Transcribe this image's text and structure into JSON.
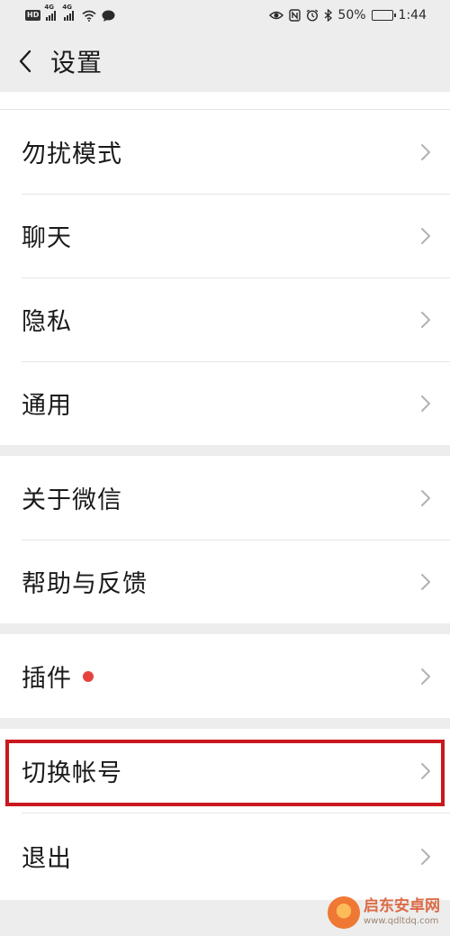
{
  "status_bar": {
    "network_badge": "HD",
    "sim1_tag": "4G",
    "sim2_tag": "4G",
    "battery_percent": "50%",
    "time": "1:44",
    "battery_level": 0.5,
    "icons": [
      "hd-icon",
      "signal-icon",
      "signal-icon",
      "wifi-icon",
      "chat-bubble-icon",
      "eye-icon",
      "nfc-icon",
      "alarm-icon",
      "bluetooth-icon",
      "battery-icon"
    ]
  },
  "header": {
    "title": "设置"
  },
  "groups": [
    {
      "items": [
        {
          "label": "勿扰模式"
        },
        {
          "label": "聊天"
        },
        {
          "label": "隐私"
        },
        {
          "label": "通用"
        }
      ]
    },
    {
      "items": [
        {
          "label": "关于微信"
        },
        {
          "label": "帮助与反馈"
        }
      ]
    },
    {
      "items": [
        {
          "label": "插件",
          "badge": "red-dot"
        }
      ]
    },
    {
      "items": [
        {
          "label": "切换帐号",
          "highlighted": true
        }
      ]
    },
    {
      "items": [
        {
          "label": "退出"
        }
      ]
    }
  ],
  "colors": {
    "background": "#ededed",
    "card": "#ffffff",
    "badge_red": "#e64340",
    "highlight_red": "#c9181e"
  },
  "watermark": {
    "name": "启东安卓网",
    "url": "www.qdltdq.com"
  }
}
